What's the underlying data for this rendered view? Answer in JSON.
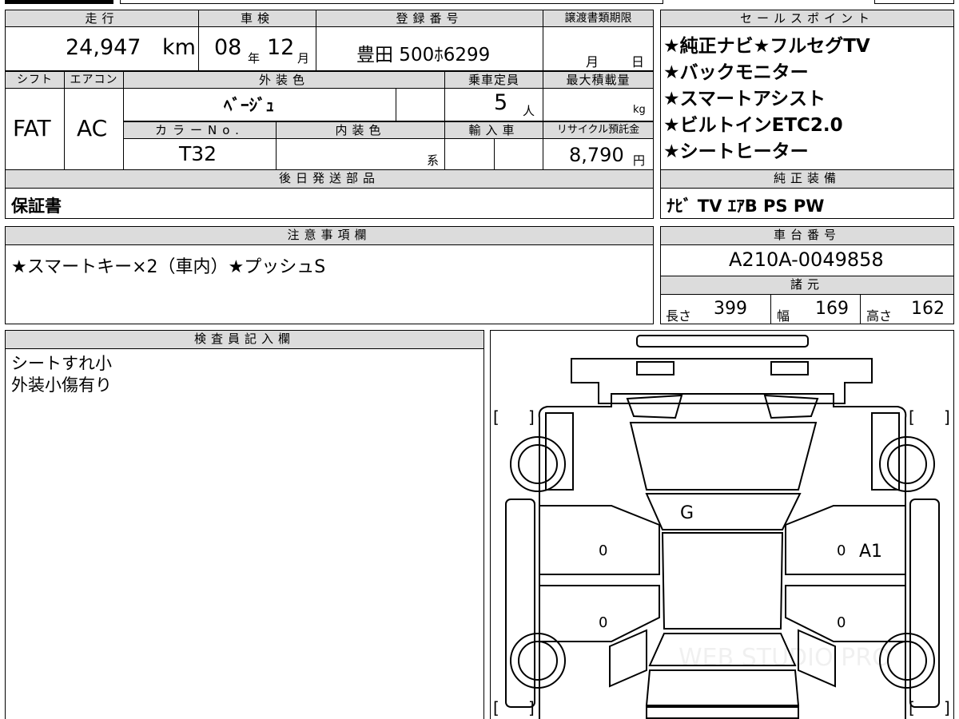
{
  "headers": {
    "mileage": "走行",
    "inspection": "車検",
    "registration": "登録番号",
    "transfer_deadline": "譲渡書類期限",
    "sales_points": "セールスポイント",
    "shift": "シフト",
    "aircon": "エアコン",
    "exterior_color": "外装色",
    "capacity": "乗車定員",
    "max_load": "最大積載量",
    "color_no": "カラーNo.",
    "interior_color": "内装色",
    "imported": "輸入車",
    "recycle_fee": "リサイクル預託金",
    "later_parts": "後日発送部品",
    "factory_equipment": "純正装備",
    "notes": "注意事項欄",
    "chassis_no": "車台番号",
    "specs": "諸元",
    "inspector_notes": "検査員記入欄"
  },
  "values": {
    "mileage": "24,947",
    "mileage_unit": "km",
    "inspection_year": "08",
    "year_unit": "年",
    "inspection_month": "12",
    "month_unit": "月",
    "registration_no": "豊田 500ﾎ6299",
    "transfer_month_unit": "月",
    "transfer_day_unit": "日",
    "shift": "FAT",
    "aircon": "AC",
    "exterior_color": "ﾍﾞｰｼﾞｭ",
    "capacity": "5",
    "capacity_unit": "人",
    "max_load_unit": "kg",
    "color_no": "T32",
    "interior_suffix": "系",
    "recycle_fee": "8,790",
    "recycle_unit": "円",
    "later_parts": "保証書",
    "factory_equipment": "ﾅﾋﾞ TV ｴｱB PS PW",
    "notes": "★スマートキー×2（車内）★プッシュS",
    "chassis_no": "A210A-0049858",
    "length_label": "長さ",
    "length": "399",
    "width_label": "幅",
    "width": "169",
    "height_label": "高さ",
    "height": "162"
  },
  "sales_points": [
    "★純正ナビ★フルセグTV",
    "★バックモニター",
    "★スマートアシスト",
    "★ビルトインETC2.0",
    "★シートヒーター"
  ],
  "inspector_notes": [
    "シートすれ小",
    "外装小傷有り"
  ],
  "diagram_marks": {
    "windshield": "G",
    "left_front_door": "0",
    "left_rear_door": "0",
    "right_front_door": "0",
    "right_rear_door": "0",
    "right_front_door_damage": "A1",
    "bracket_open": "[",
    "bracket_close": "]"
  },
  "watermark": "WEB STUDIO PRO"
}
